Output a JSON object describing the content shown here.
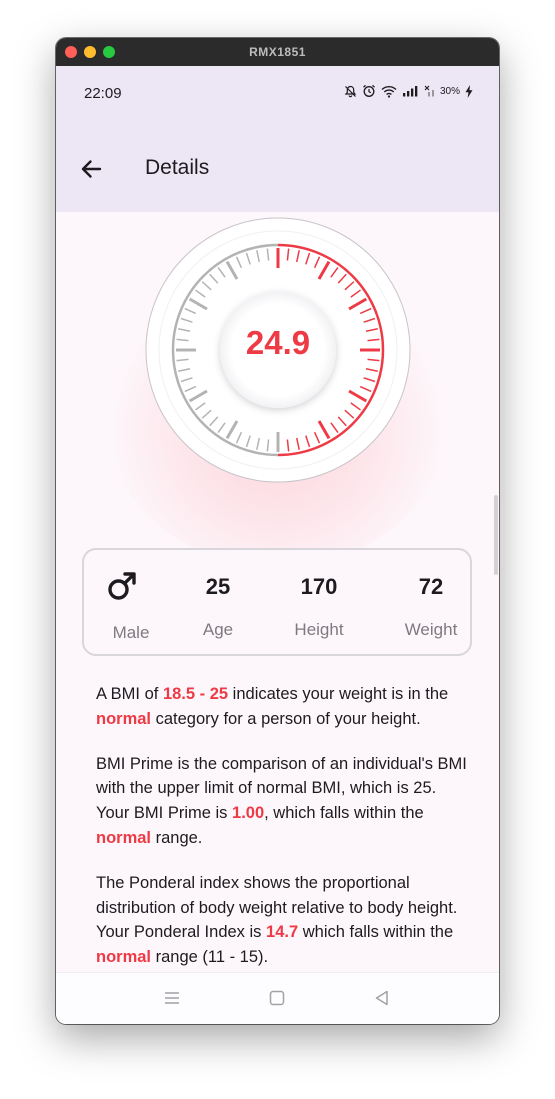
{
  "window": {
    "title": "RMX1851"
  },
  "statusbar": {
    "time": "22:09",
    "battery": "30%"
  },
  "appbar": {
    "title": "Details"
  },
  "gauge": {
    "value": "24.9",
    "level_fraction": 0.5,
    "accent_color": "#ee3a45",
    "track_color": "#b3b3b3"
  },
  "stats": {
    "gender": {
      "label": "Male",
      "icon": "male-symbol-icon"
    },
    "age": {
      "value": "25",
      "label": "Age"
    },
    "height": {
      "value": "170",
      "label": "Height"
    },
    "weight": {
      "value": "72",
      "label": "Weight"
    }
  },
  "paragraphs": {
    "p1": {
      "a": "A BMI of ",
      "b": "18.5 - 25",
      "c": " indicates your weight is in the ",
      "d": "normal",
      "e": " category for a person of your height."
    },
    "p2": {
      "a": "BMI Prime is the comparison of an individual's BMI with the upper limit of normal BMI, which is 25. Your BMI Prime is ",
      "b": "1.00",
      "c": ", which falls within the ",
      "d": "normal",
      "e": " range."
    },
    "p3": {
      "a": "The Ponderal index shows the proportional distribution of body weight relative to body height. Your Ponderal Index is ",
      "b": "14.7",
      "c": " which falls within the ",
      "d": "normal",
      "e": " range (11 - 15)."
    }
  },
  "navbar": {
    "items": [
      "menu-icon",
      "home-square-icon",
      "back-triangle-icon"
    ]
  }
}
